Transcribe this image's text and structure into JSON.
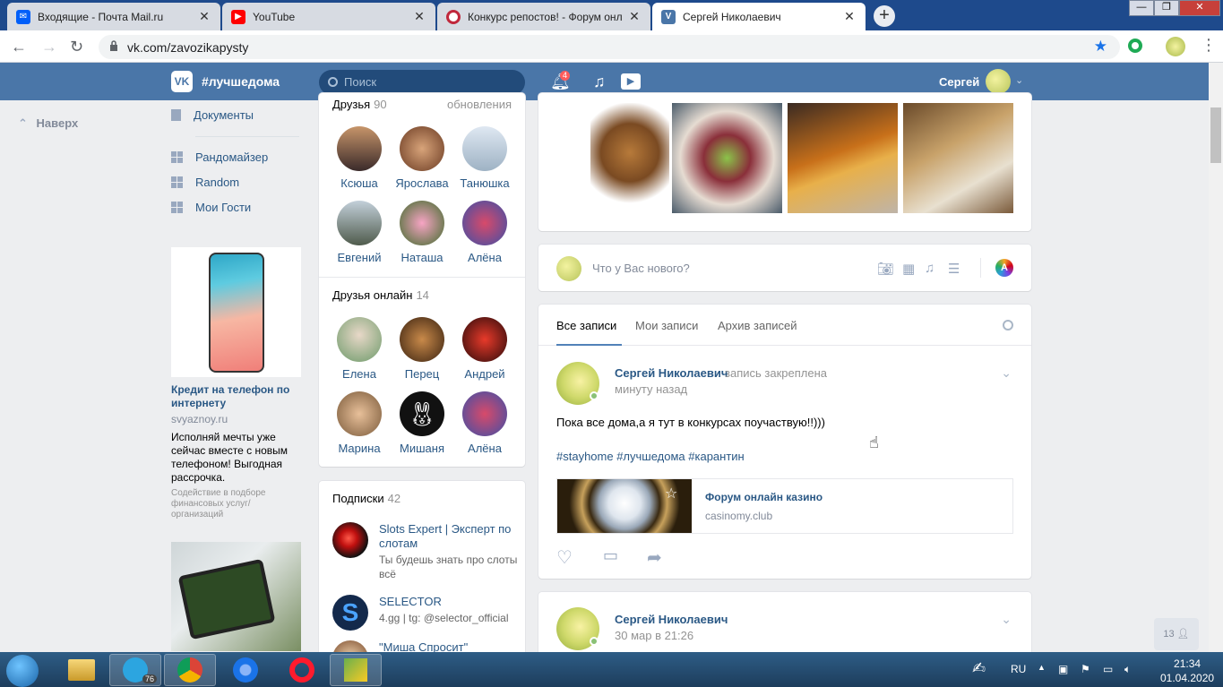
{
  "browser": {
    "tabs": [
      {
        "title": "Входящие - Почта Mail.ru",
        "icon": "mail-icon",
        "color": "#005ff9"
      },
      {
        "title": "YouTube",
        "icon": "youtube-icon",
        "color": "#ff0000"
      },
      {
        "title": "Конкурс репостов! - Форум онл",
        "icon": "forum-icon",
        "color": "#c0283c"
      },
      {
        "title": "Сергей Николаевич",
        "icon": "vk-icon",
        "color": "#4a76a8"
      }
    ],
    "url": "vk.com/zavozikapysty"
  },
  "vk": {
    "logo": "VK",
    "brand": "#лучшедома",
    "search_placeholder": "Поиск",
    "notif_count": "4",
    "user_name": "Сергей"
  },
  "left": {
    "back_label": "Наверх",
    "nav": [
      {
        "label": "Документы",
        "icon": "document-icon"
      },
      {
        "label": "Рандомайзер",
        "icon": "apps-icon"
      },
      {
        "label": "Random",
        "icon": "apps-icon"
      },
      {
        "label": "Мои Гости",
        "icon": "apps-icon"
      }
    ],
    "ad": {
      "title": "Кредит на телефон по интернету",
      "domain": "svyaznoy.ru",
      "text": "Исполняй мечты уже сейчас вместе с новым телефоном! Выгодная рассрочка.",
      "disclaimer": "Содействие в подборе финансовых услуг/организаций"
    }
  },
  "friends": {
    "title": "Друзья",
    "count": "90",
    "updates": "обновления",
    "items": [
      {
        "name": "Ксюша",
        "color": "#c7956a"
      },
      {
        "name": "Ярослава",
        "color": "#8a5a3a"
      },
      {
        "name": "Танюшка",
        "color": "#c9d7e6"
      },
      {
        "name": "Евгений",
        "color": "#7d8f9c"
      },
      {
        "name": "Наташа",
        "color": "#e26b9a"
      },
      {
        "name": "Алёна",
        "color": "#8a7fb8"
      }
    ]
  },
  "online": {
    "title": "Друзья онлайн",
    "count": "14",
    "items": [
      {
        "name": "Елена",
        "color": "#9fb7c8"
      },
      {
        "name": "Перец",
        "color": "#8b5a2e"
      },
      {
        "name": "Андрей",
        "color": "#b52a1e"
      },
      {
        "name": "Марина",
        "color": "#c99b6e"
      },
      {
        "name": "Мишаня",
        "color": "#111111"
      },
      {
        "name": "Алёна",
        "color": "#8a7fb8"
      }
    ]
  },
  "subs": {
    "title": "Подписки",
    "count": "42",
    "items": [
      {
        "name": "Slots Expert | Эксперт по слотам",
        "desc": "Ты будешь знать про слоты всё",
        "color": "#c0100f"
      },
      {
        "name": "SELECTOR",
        "desc": "4.gg | tg: @selector_official",
        "color": "#1a3d6e"
      },
      {
        "name": "\"Миша Спросит\"",
        "desc": "",
        "color": "#e8c9a0"
      }
    ]
  },
  "composer": {
    "placeholder": "Что у Вас нового?"
  },
  "wall": {
    "tabs": [
      "Все записи",
      "Мои записи",
      "Архив записей"
    ],
    "post1": {
      "author": "Сергей Николаевич",
      "pinned": "запись закреплена",
      "time": "минуту назад",
      "text": "Пока все дома,а я тут в конкурсах поучаствую!!)))",
      "tags": "#stayhome #лучшедома #карантин",
      "link_title": "Форум онлайн казино",
      "link_domain": "casinomy.club"
    },
    "post2": {
      "author": "Сергей Николаевич",
      "time": "30 мар в 21:26"
    }
  },
  "online_counter": "13",
  "taskbar": {
    "telegram_badge": "76",
    "lang": "RU",
    "time": "21:34",
    "date": "01.04.2020"
  }
}
